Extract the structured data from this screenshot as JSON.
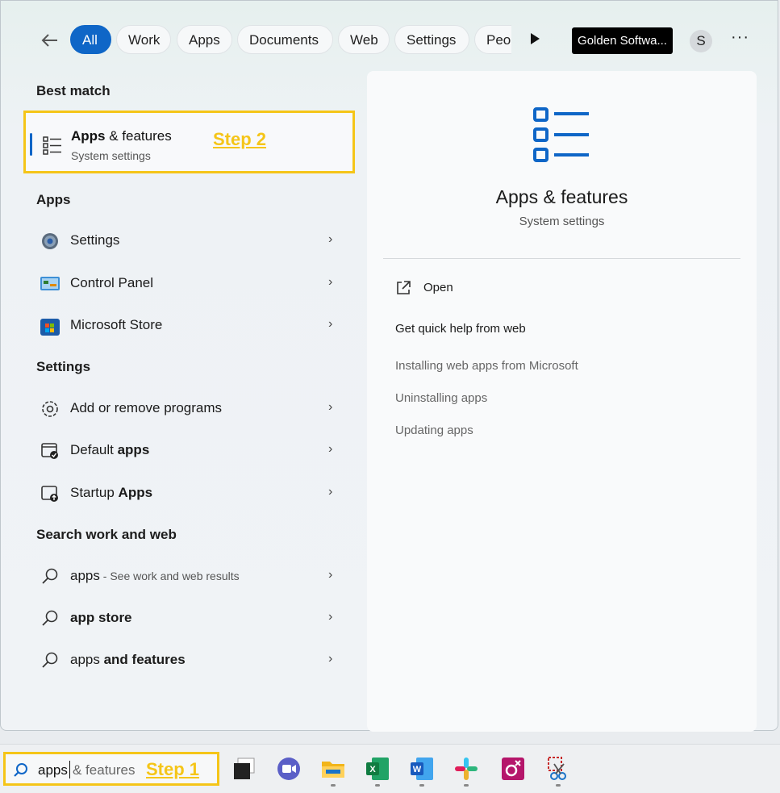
{
  "filters": [
    "All",
    "Work",
    "Apps",
    "Documents",
    "Web",
    "Settings",
    "Peo"
  ],
  "org_name": "Golden Softwa...",
  "avatar_letter": "S",
  "more_label": "···",
  "best_match": {
    "heading": "Best match",
    "title_bold": "Apps",
    "title_rest": " & features",
    "subtitle": "System settings",
    "step": "Step 2",
    "step_color": "#f5c518"
  },
  "apps_section": {
    "heading": "Apps",
    "items": [
      {
        "label": "Settings",
        "icon": "settings-gear-icon"
      },
      {
        "label": "Control Panel",
        "icon": "control-panel-icon"
      },
      {
        "label": "Microsoft Store",
        "icon": "microsoft-store-icon"
      }
    ]
  },
  "settings_section": {
    "heading": "Settings",
    "items": [
      {
        "pre": "Add or remove programs",
        "bold": "",
        "icon": "gear-outline-icon"
      },
      {
        "pre": "Default ",
        "bold": "apps",
        "icon": "default-apps-icon"
      },
      {
        "pre": "Startup ",
        "bold": "Apps",
        "icon": "startup-apps-icon"
      }
    ]
  },
  "web_section": {
    "heading": "Search work and web",
    "items": [
      {
        "pre": "apps",
        "hint": " - See work and web results",
        "bold": ""
      },
      {
        "pre": "",
        "hint": "",
        "bold": "app store"
      },
      {
        "pre": "apps ",
        "hint": "",
        "bold": "and features"
      }
    ]
  },
  "detail": {
    "title": "Apps & features",
    "subtitle": "System settings",
    "open_label": "Open",
    "help_heading": "Get quick help from web",
    "links": [
      "Installing web apps from Microsoft",
      "Uninstalling apps",
      "Updating apps"
    ]
  },
  "taskbar": {
    "search_typed": "apps",
    "search_ghost": "& features",
    "step": "Step 1",
    "apps": [
      "task-view-icon",
      "teams-chat-icon",
      "file-explorer-icon",
      "excel-icon",
      "word-icon",
      "slack-icon",
      "app-icon",
      "snipping-tool-icon"
    ]
  },
  "colors": {
    "accent": "#0f66c7",
    "highlight": "#f5c518"
  }
}
